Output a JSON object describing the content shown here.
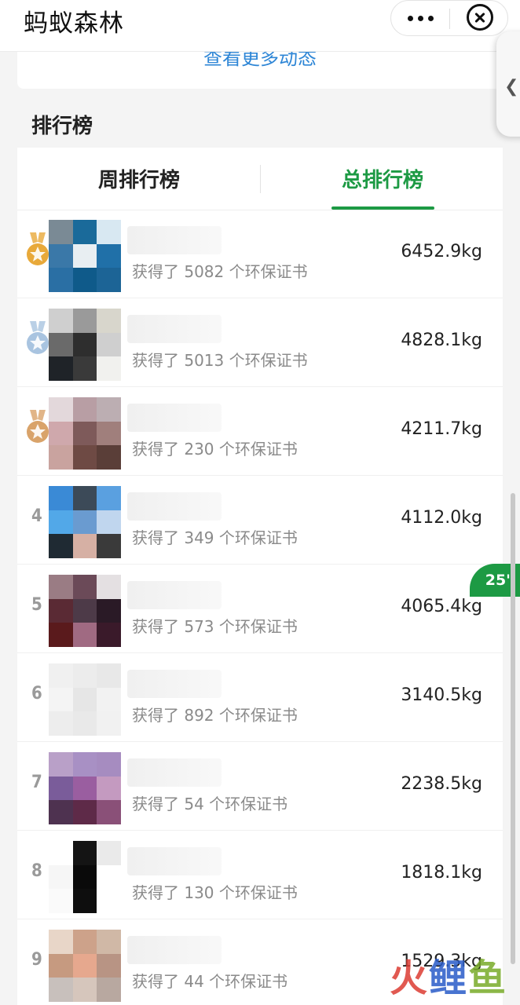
{
  "nav": {
    "title": "蚂蚁森林"
  },
  "top_link": "查看更多动态",
  "section_title": "排行榜",
  "tabs": {
    "week": "周排行榜",
    "total": "总排行榜"
  },
  "badge": "25'",
  "watermark": "火鲤鱼",
  "leaderboard": [
    {
      "rank": "1",
      "medal": "gold",
      "certificates": "获得了 5082 个环保证书",
      "amount": "6452.9kg"
    },
    {
      "rank": "2",
      "medal": "silver",
      "certificates": "获得了 5013 个环保证书",
      "amount": "4828.1kg"
    },
    {
      "rank": "3",
      "medal": "bronze",
      "certificates": "获得了 230 个环保证书",
      "amount": "4211.7kg"
    },
    {
      "rank": "4",
      "certificates": "获得了 349 个环保证书",
      "amount": "4112.0kg"
    },
    {
      "rank": "5",
      "certificates": "获得了 573 个环保证书",
      "amount": "4065.4kg"
    },
    {
      "rank": "6",
      "certificates": "获得了 892 个环保证书",
      "amount": "3140.5kg"
    },
    {
      "rank": "7",
      "certificates": "获得了 54 个环保证书",
      "amount": "2238.5kg"
    },
    {
      "rank": "8",
      "certificates": "获得了 130 个环保证书",
      "amount": "1818.1kg"
    },
    {
      "rank": "9",
      "certificates": "获得了 44 个环保证书",
      "amount": "1529.3kg"
    }
  ],
  "colors": {
    "accent_green": "#1d9a44",
    "link_blue": "#2e86d6",
    "medal_gold": "#e8a93a",
    "medal_silver": "#a9c4e0",
    "medal_bronze": "#d9a36a"
  }
}
